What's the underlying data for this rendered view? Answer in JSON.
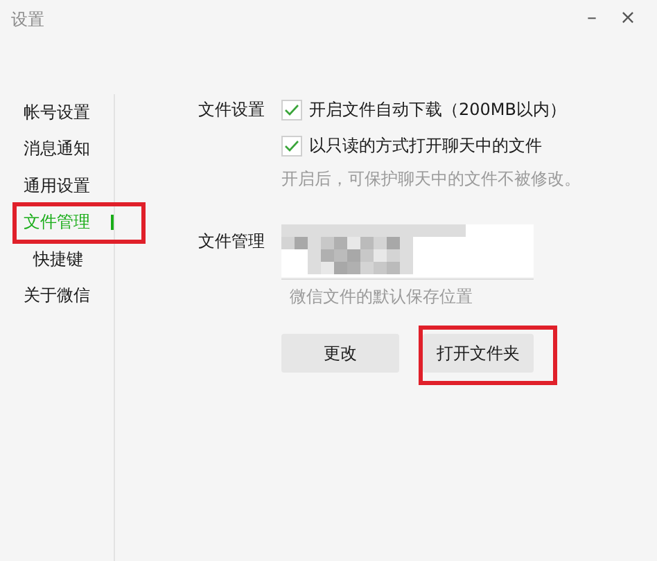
{
  "window": {
    "title": "设置",
    "controls": [
      "–",
      "×"
    ]
  },
  "sidebar": {
    "items": [
      {
        "label": "帐号设置",
        "selected": false,
        "highlighted": false
      },
      {
        "label": "消息通知",
        "selected": false,
        "highlighted": false
      },
      {
        "label": "通用设置",
        "selected": false,
        "highlighted": false
      },
      {
        "label": "文件管理",
        "selected": true,
        "highlighted": true
      },
      {
        "label": "快捷键",
        "selected": false,
        "highlighted": false
      },
      {
        "label": "关于微信",
        "selected": false,
        "highlighted": false
      }
    ]
  },
  "file_settings": {
    "label": "文件设置",
    "options": [
      {
        "label": "开启文件自动下载（200MB以内）",
        "checked": true
      },
      {
        "label": "以只读的方式打开聊天中的文件",
        "checked": true
      }
    ],
    "hint": "开启后，可保护聊天中的文件不被修改。"
  },
  "file_management": {
    "label": "文件管理",
    "path": {
      "kind": "redacted"
    },
    "hint": "微信文件的默认保存位置",
    "buttons": [
      {
        "label": "更改",
        "highlighted": false
      },
      {
        "label": "打开文件夹",
        "highlighted": true
      }
    ]
  }
}
